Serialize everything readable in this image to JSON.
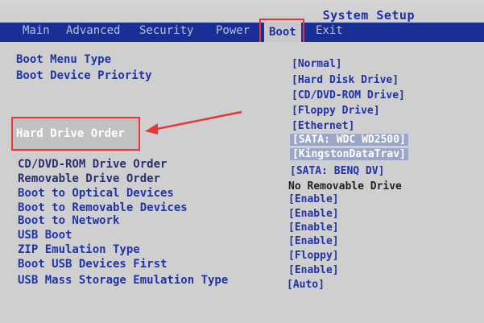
{
  "window": {
    "title": "System Setup"
  },
  "tabs": [
    {
      "label": "Main"
    },
    {
      "label": "Advanced"
    },
    {
      "label": "Security"
    },
    {
      "label": "Power"
    },
    {
      "label": "Boot"
    },
    {
      "label": "Exit"
    }
  ],
  "options": [
    {
      "label": "Boot Menu Type",
      "value": "[Normal]"
    },
    {
      "label": "Boot Device Priority",
      "value": "[Hard Disk Drive]"
    },
    {
      "value": "[CD/DVD-ROM Drive]"
    },
    {
      "value": "[Floppy Drive]"
    },
    {
      "value": "[Ethernet]"
    },
    {
      "label": "Hard Drive Order",
      "value": "[SATA: WDC WD2500]"
    },
    {
      "value": "[KingstonDataTrav]"
    },
    {
      "label": "CD/DVD-ROM Drive Order",
      "value": "[SATA: BENQ     DV]"
    },
    {
      "label": "Removable Drive Order",
      "value": "No Removable Drive"
    },
    {
      "label": "Boot to Optical Devices",
      "value": "[Enable]"
    },
    {
      "label": "Boot to Removable Devices",
      "value": "[Enable]"
    },
    {
      "label": "Boot to Network",
      "value": "[Enable]"
    },
    {
      "label": "USB Boot",
      "value": "[Enable]"
    },
    {
      "label": "ZIP Emulation Type",
      "value": "[Floppy]"
    },
    {
      "label": "Boot USB Devices First",
      "value": "[Enable]"
    },
    {
      "label": "USB Mass Storage Emulation Type",
      "value": "[Auto]"
    }
  ]
}
